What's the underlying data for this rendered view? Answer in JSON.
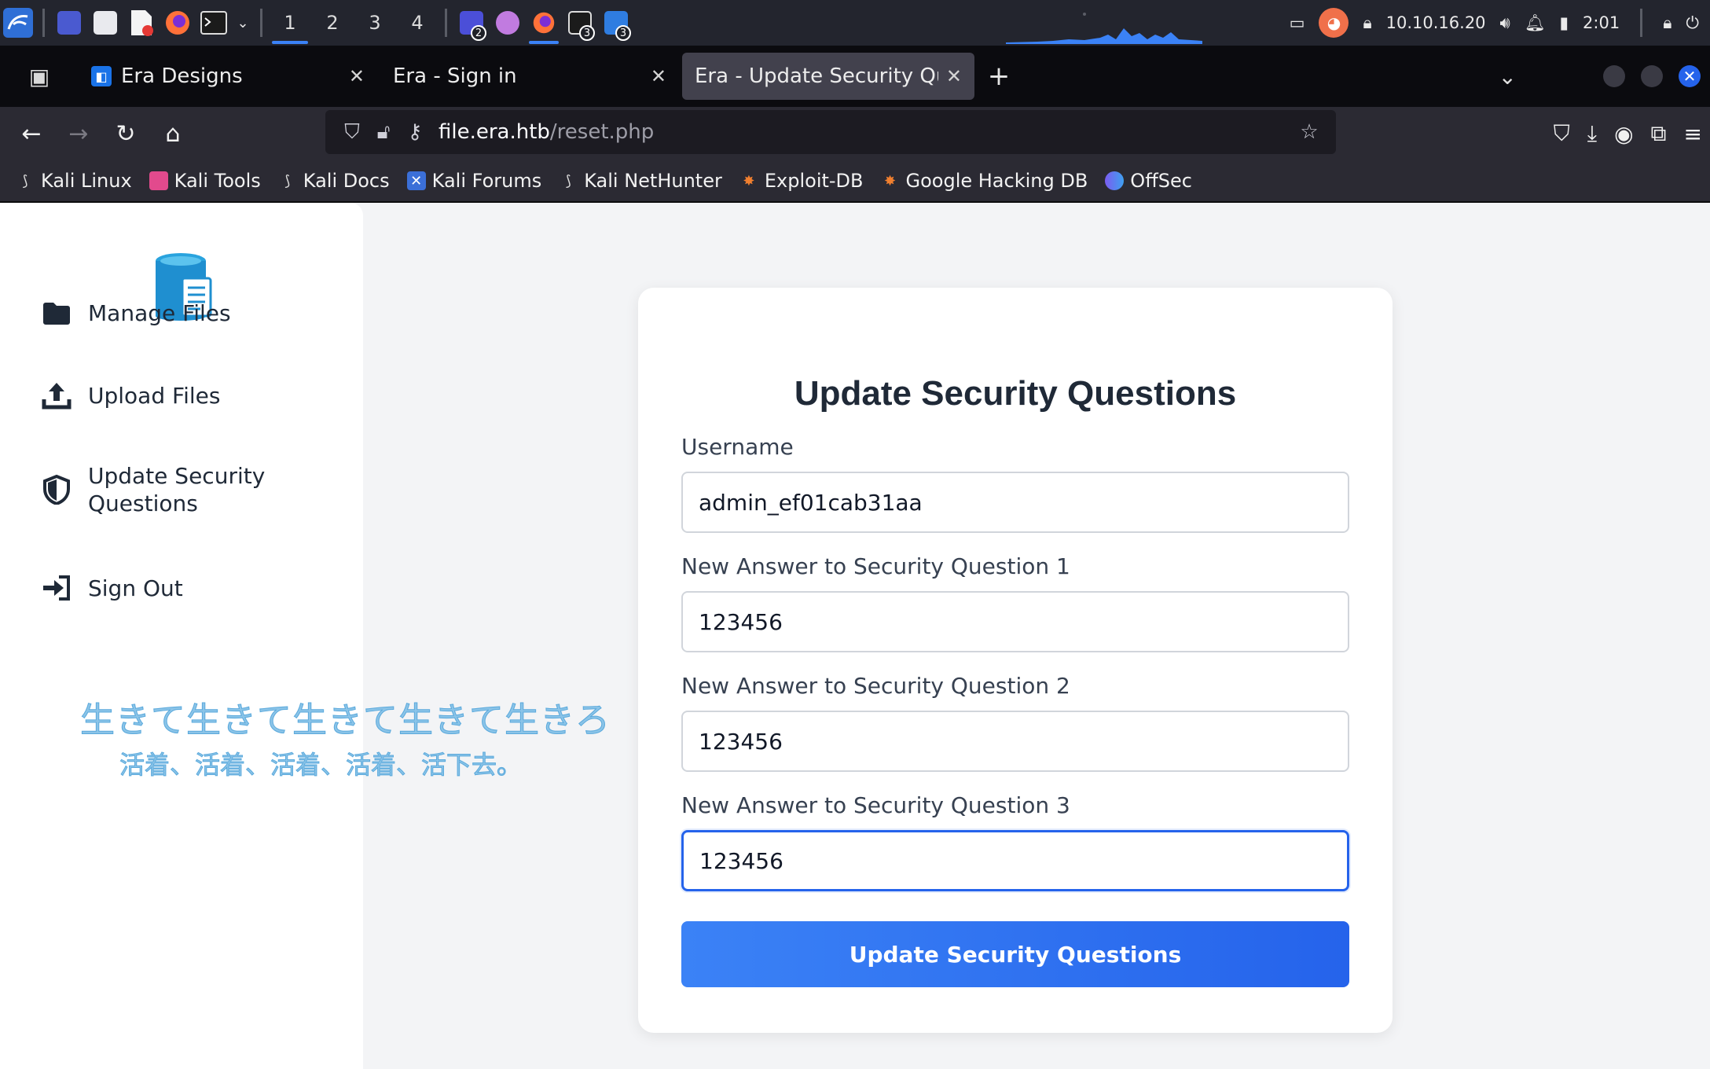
{
  "taskbar": {
    "workspaces": [
      "1",
      "2",
      "3",
      "4"
    ],
    "active_workspace": "1",
    "badges": [
      "2",
      "3",
      "3"
    ],
    "ip": "10.10.16.20",
    "clock": "2:01"
  },
  "browser": {
    "tabs": [
      {
        "title": "Era Designs",
        "active": false
      },
      {
        "title": "Era - Sign in",
        "active": false
      },
      {
        "title": "Era - Update Security Questions",
        "active": true
      }
    ],
    "url_host": "file.era.htb",
    "url_path": "/reset.php",
    "bookmarks": [
      "Kali Linux",
      "Kali Tools",
      "Kali Docs",
      "Kali Forums",
      "Kali NetHunter",
      "Exploit-DB",
      "Google Hacking DB",
      "OffSec"
    ]
  },
  "sidebar": {
    "items": [
      {
        "label": "Manage Files",
        "icon": "folder-icon"
      },
      {
        "label": "Upload Files",
        "icon": "upload-icon"
      },
      {
        "label": "Update Security Questions",
        "icon": "shield-icon"
      },
      {
        "label": "Sign Out",
        "icon": "sign-out-icon"
      }
    ],
    "overlay_line1": "生きて生きて生きて生きて生きろ",
    "overlay_line2": "活着、活着、活着、活着、活下去。"
  },
  "form": {
    "title": "Update Security Questions",
    "username_label": "Username",
    "username_value": "admin_ef01cab31aa",
    "q1_label": "New Answer to Security Question 1",
    "q1_value": "123456",
    "q2_label": "New Answer to Security Question 2",
    "q2_value": "123456",
    "q3_label": "New Answer to Security Question 3",
    "q3_value": "123456",
    "submit_label": "Update Security Questions"
  },
  "colors": {
    "accent": "#2563eb",
    "panel": "#23252e",
    "text_dark": "#1f2937"
  }
}
